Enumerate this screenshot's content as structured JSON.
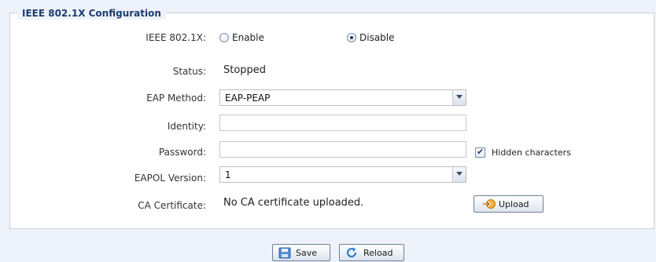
{
  "section_title": "IEEE 802.1X Configuration",
  "ieee8021x": {
    "label": "IEEE 802.1X:",
    "options": [
      {
        "label": "Enable",
        "selected": false
      },
      {
        "label": "Disable",
        "selected": true
      }
    ]
  },
  "status": {
    "label": "Status:",
    "value": "Stopped"
  },
  "eap_method": {
    "label": "EAP Method:",
    "value": "EAP-PEAP"
  },
  "identity": {
    "label": "Identity:",
    "value": ""
  },
  "password": {
    "label": "Password:",
    "value": "",
    "hidden_characters_label": "Hidden characters",
    "hidden_characters_checked": true
  },
  "eapol_version": {
    "label": "EAPOL Version:",
    "value": "1"
  },
  "ca_certificate": {
    "label": "CA Certificate:",
    "value": "No CA certificate uploaded.",
    "upload_label": "Upload"
  },
  "actions": {
    "save_label": "Save",
    "reload_label": "Reload"
  },
  "icons": {
    "upload": "upload-arrow-icon",
    "save": "floppy-disk-icon",
    "reload": "refresh-icon",
    "dropdown": "chevron-down-icon"
  },
  "colors": {
    "background": "#eef3fb",
    "legend_text": "#1d3c70",
    "panel_border": "#c9d0da"
  }
}
